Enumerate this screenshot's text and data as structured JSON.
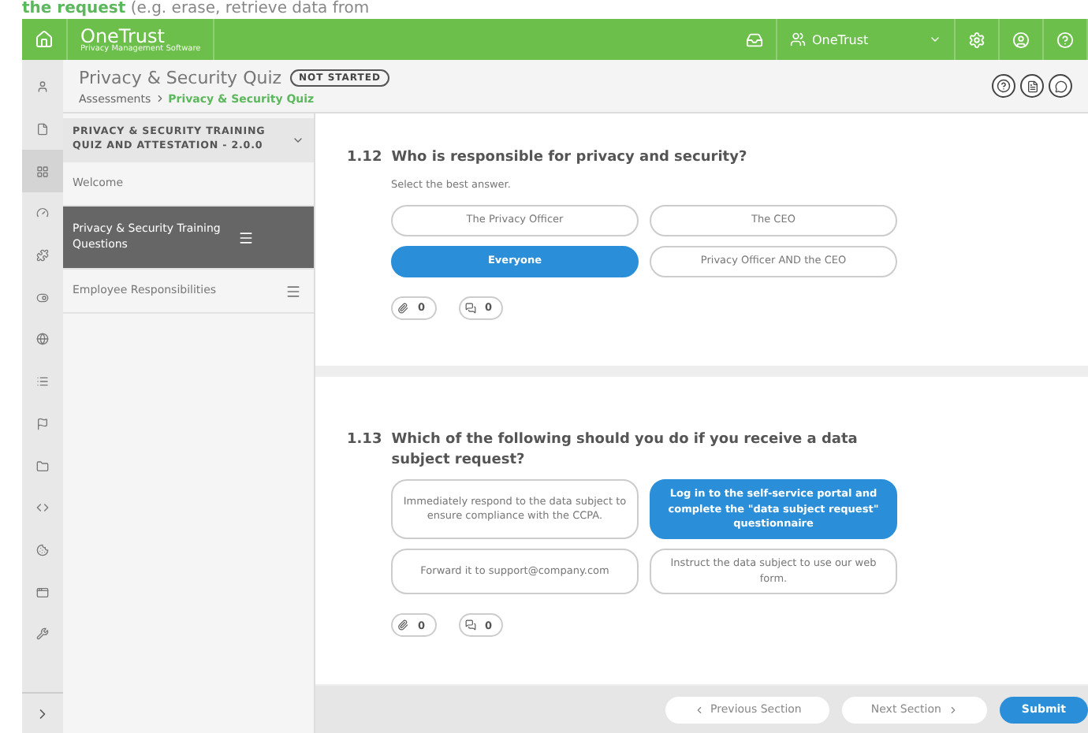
{
  "backdrop_text": "**the request** (e.g. erase, retrieve data from",
  "topbar": {
    "logo": "OneTrust",
    "tagline": "Privacy Management Software",
    "org": "OneTrust"
  },
  "rail": [
    {
      "kind": "user",
      "selected": false
    },
    {
      "kind": "doc",
      "selected": false
    },
    {
      "kind": "grid",
      "selected": true
    },
    {
      "kind": "gauge",
      "selected": false
    },
    {
      "kind": "puzzle",
      "selected": false
    },
    {
      "kind": "toggle",
      "selected": false
    },
    {
      "kind": "globe",
      "selected": false
    },
    {
      "kind": "list",
      "selected": false
    },
    {
      "kind": "flag",
      "selected": false
    },
    {
      "kind": "folder",
      "selected": false
    },
    {
      "kind": "code",
      "selected": false
    },
    {
      "kind": "cookie",
      "selected": false
    },
    {
      "kind": "window",
      "selected": false
    },
    {
      "kind": "wrench",
      "selected": false
    }
  ],
  "header": {
    "title": "Privacy & Security Quiz",
    "status": "NOT STARTED",
    "breadcrumb": [
      "Assessments",
      "Privacy & Security Quiz"
    ]
  },
  "sidebar": {
    "title": "PRIVACY & SECURITY TRAINING QUIZ AND ATTESTATION - 2.0.0",
    "items": [
      {
        "label": "Welcome",
        "selected": false,
        "menu": false
      },
      {
        "label": "Privacy & Security Training Questions",
        "selected": true,
        "menu": true
      },
      {
        "label": "Employee Responsibilities",
        "selected": false,
        "menu": true
      }
    ]
  },
  "questions": [
    {
      "number": "1.12",
      "text": "Who is responsible for privacy and security?",
      "hint": "Select the best answer.",
      "options": [
        {
          "label": "The Privacy Officer",
          "selected": false
        },
        {
          "label": "The CEO",
          "selected": false
        },
        {
          "label": "Everyone",
          "selected": true
        },
        {
          "label": "Privacy Officer AND the CEO",
          "selected": false
        }
      ],
      "attachments": "0",
      "comments": "0"
    },
    {
      "number": "1.13",
      "text": "Which of the following should you do if you receive a data subject request?",
      "options": [
        {
          "label": "Immediately respond to the data subject to ensure compliance with the CCPA.",
          "selected": false
        },
        {
          "label": "Log in to the self-service portal and complete the \"data subject request\" questionnaire",
          "selected": true
        },
        {
          "label": "Forward it to support@company.com",
          "selected": false
        },
        {
          "label": "Instruct the data subject to use our web form.",
          "selected": false
        }
      ],
      "attachments": "0",
      "comments": "0"
    }
  ],
  "footer": {
    "previous": "Previous Section",
    "next": "Next Section",
    "submit": "Submit"
  }
}
